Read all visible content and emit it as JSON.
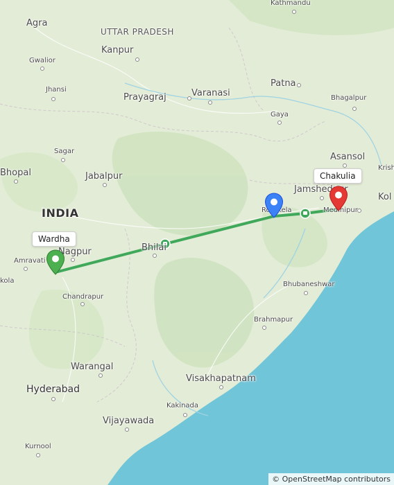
{
  "map": {
    "colors": {
      "land": "#e3ecd6",
      "forest": "#cfe3c0",
      "water": "#71c5d8",
      "route": "#3fa85a",
      "pin_origin": "#4caf50",
      "pin_current": "#3b82f6",
      "pin_destination": "#e53935"
    },
    "country_label": "INDIA",
    "state_labels": [
      "UTTAR PRADESH"
    ],
    "cities": [
      {
        "id": "kathmandu",
        "name": "Kathmandu",
        "size": "sm"
      },
      {
        "id": "agra",
        "name": "Agra",
        "size": "md"
      },
      {
        "id": "kanpur",
        "name": "Kanpur",
        "size": "md"
      },
      {
        "id": "gwalior",
        "name": "Gwalior",
        "size": "sm"
      },
      {
        "id": "prayagraj",
        "name": "Prayagraj",
        "size": "md"
      },
      {
        "id": "varanasi",
        "name": "Varanasi",
        "size": "md"
      },
      {
        "id": "patna",
        "name": "Patna",
        "size": "md"
      },
      {
        "id": "jhansi",
        "name": "Jhansi",
        "size": "sm"
      },
      {
        "id": "bhagalpur",
        "name": "Bhagalpur",
        "size": "sm"
      },
      {
        "id": "gaya",
        "name": "Gaya",
        "size": "sm"
      },
      {
        "id": "sagar",
        "name": "Sagar",
        "size": "sm"
      },
      {
        "id": "asansol",
        "name": "Asansol",
        "size": "md"
      },
      {
        "id": "bhopal",
        "name": "Bhopal",
        "size": "md"
      },
      {
        "id": "jabalpur",
        "name": "Jabalpur",
        "size": "md"
      },
      {
        "id": "krish",
        "name": "Krish",
        "size": "sm"
      },
      {
        "id": "jamshedpur",
        "name": "Jamshedpur",
        "size": "md"
      },
      {
        "id": "kol",
        "name": "Kol",
        "size": "md"
      },
      {
        "id": "rourkela",
        "name": "Rourkela",
        "size": "sm"
      },
      {
        "id": "medinipur",
        "name": "Medinipur",
        "size": "sm"
      },
      {
        "id": "nagpur",
        "name": "Nagpur",
        "size": "md"
      },
      {
        "id": "bhilai",
        "name": "Bhilai",
        "size": "md"
      },
      {
        "id": "amravati",
        "name": "Amravati",
        "size": "sm"
      },
      {
        "id": "akola",
        "name": "kola",
        "size": "sm"
      },
      {
        "id": "bhubaneshwar",
        "name": "Bhubaneshwar",
        "size": "sm"
      },
      {
        "id": "chandrapur",
        "name": "Chandrapur",
        "size": "sm"
      },
      {
        "id": "brahmapur",
        "name": "Brahmapur",
        "size": "sm"
      },
      {
        "id": "warangal",
        "name": "Warangal",
        "size": "md"
      },
      {
        "id": "visakhapatnam",
        "name": "Visakhapatnam",
        "size": "md"
      },
      {
        "id": "hyderabad",
        "name": "Hyderabad",
        "size": "lg"
      },
      {
        "id": "kakinada",
        "name": "Kakinada",
        "size": "sm"
      },
      {
        "id": "vijayawada",
        "name": "Vijayawada",
        "size": "md"
      },
      {
        "id": "kurnool",
        "name": "Kurnool",
        "size": "sm"
      }
    ],
    "markers": {
      "origin": {
        "label": "Wardha",
        "icon": "map-pin-icon"
      },
      "current": {
        "icon": "map-pin-icon"
      },
      "destination": {
        "label": "Chakulia",
        "icon": "map-pin-icon"
      }
    },
    "attribution": "© OpenStreetMap contributors"
  }
}
